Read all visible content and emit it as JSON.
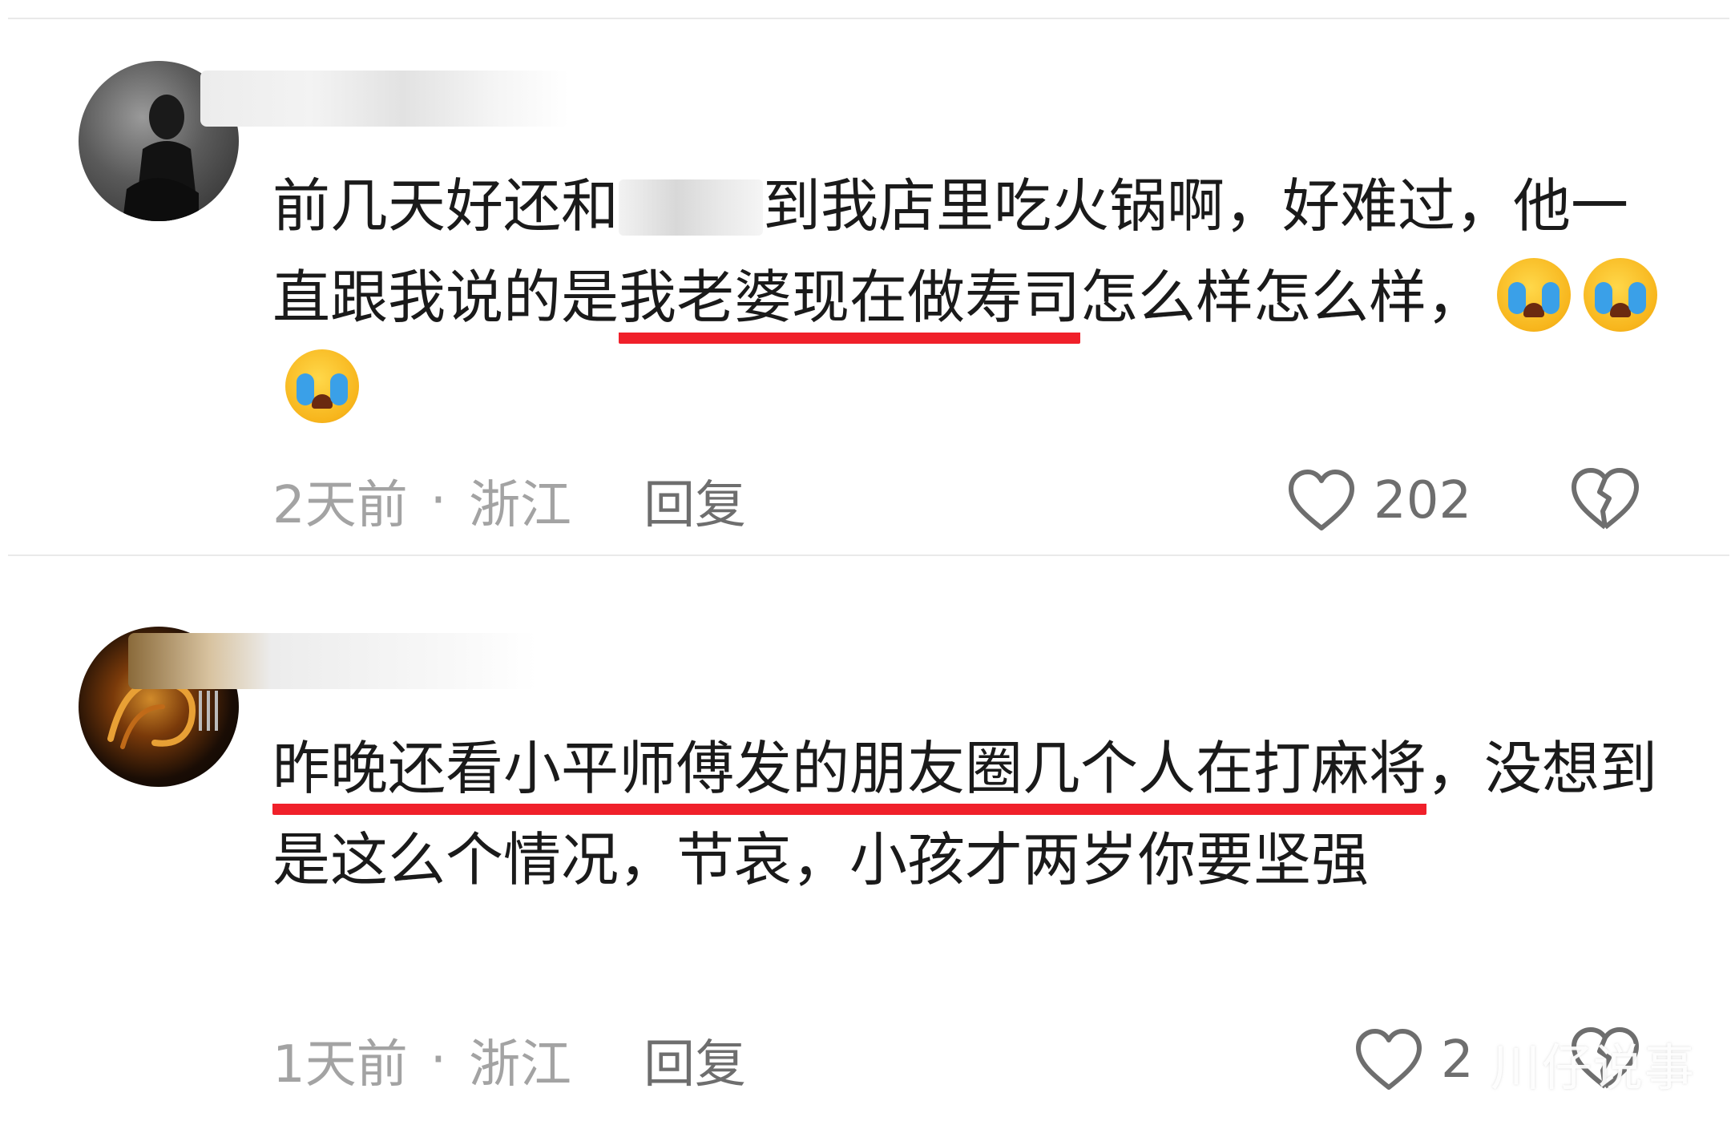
{
  "comments": [
    {
      "text_before": "前几天好还和",
      "text_redacted": "",
      "text_mid": "到我店里吃火锅啊，好难过，他一直跟我说的是",
      "text_highlight": "我老婆现在做寿司",
      "text_after": "怎么样怎么样，",
      "emoji_count": 3,
      "time": "2天前",
      "separator": "·",
      "location": "浙江",
      "reply_label": "回复",
      "like_count": "202"
    },
    {
      "text_highlight": "昨晚还看小平师傅发的朋友圈几个人在打麻将",
      "text_after": "，没想到是这么个情况，节哀，小孩才两岁你要坚强",
      "time": "1天前",
      "separator": "·",
      "location": "浙江",
      "reply_label": "回复",
      "like_count": "2"
    }
  ],
  "watermark": "川仔说事",
  "colors": {
    "highlight_underline": "#f0202a",
    "meta_text": "#a3a3a3",
    "body_text": "#1a1a1a"
  }
}
